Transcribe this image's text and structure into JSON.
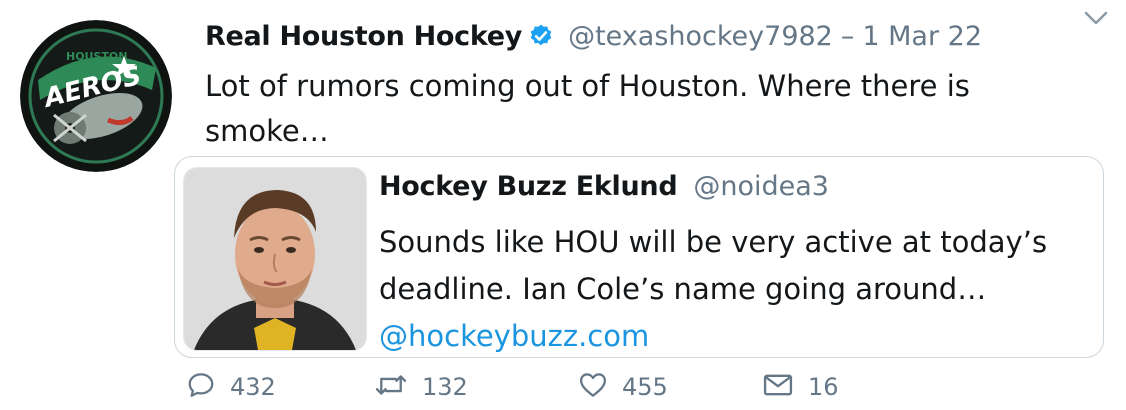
{
  "tweet": {
    "display_name": "Real Houston Hockey",
    "handle": "@texashockey7982",
    "separator": "–",
    "date": "1 Mar 22",
    "text": "Lot of rumors coming out of Houston. Where there is smoke…",
    "avatar_text": {
      "top": "HOUSTON",
      "main": "AEROS"
    }
  },
  "quote": {
    "display_name": "Hockey Buzz Eklund",
    "handle": "@noidea3",
    "text": "Sounds like HOU will be very active at today’s deadline. Ian Cole’s name going around…",
    "link": "@hockeybuzz.com"
  },
  "actions": {
    "replies": "432",
    "retweets": "132",
    "likes": "455",
    "dm": "16"
  },
  "icons": {
    "verified": "verified-badge-icon",
    "caret": "chevron-down-icon",
    "reply": "reply-icon",
    "retweet": "retweet-icon",
    "like": "heart-icon",
    "dm": "envelope-icon"
  },
  "colors": {
    "text": "#14171a",
    "secondary": "#657786",
    "link": "#1b95e0",
    "border": "#ccd6dd",
    "verified": "#1da1f2"
  }
}
